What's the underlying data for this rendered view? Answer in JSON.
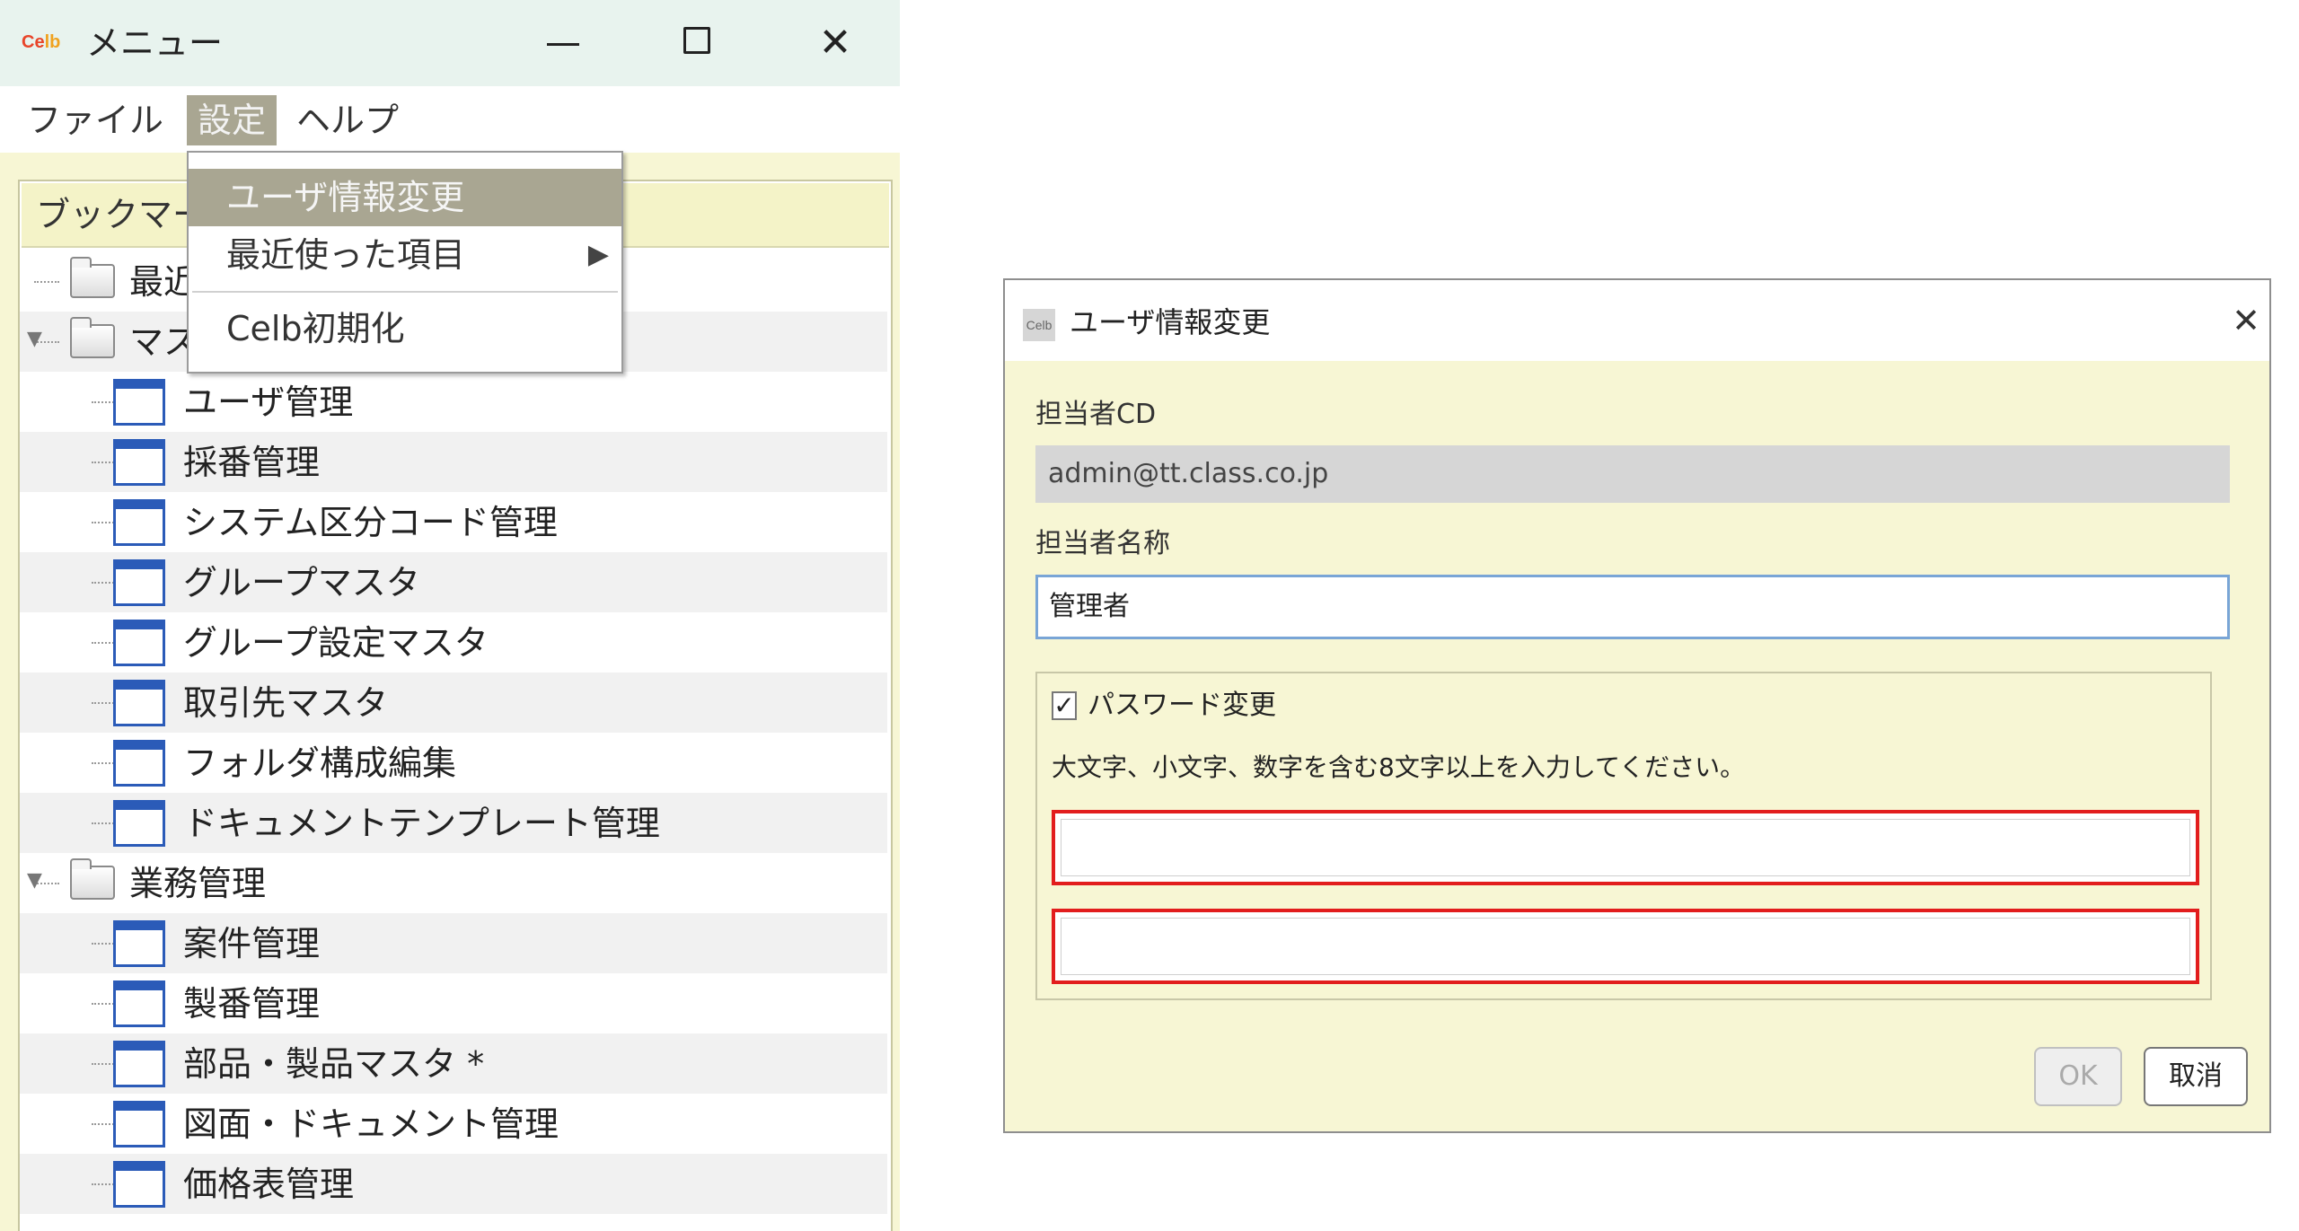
{
  "menu_window": {
    "title": "メニュー",
    "logo": {
      "part1": "Ce",
      "part2": "lb"
    },
    "close_glyph": "✕",
    "menubar": {
      "file": "ファイル",
      "settings": "設定",
      "help": "ヘルプ"
    },
    "bookmark_title": "ブックマーク",
    "tree": [
      {
        "type": "folder",
        "label": "最近",
        "expanded": false
      },
      {
        "type": "folder",
        "label": "マス",
        "expanded": true
      },
      {
        "type": "screen",
        "label": "ユーザ管理"
      },
      {
        "type": "screen",
        "label": "採番管理"
      },
      {
        "type": "screen",
        "label": "システム区分コード管理"
      },
      {
        "type": "screen",
        "label": "グループマスタ"
      },
      {
        "type": "screen",
        "label": "グループ設定マスタ"
      },
      {
        "type": "screen",
        "label": "取引先マスタ"
      },
      {
        "type": "screen",
        "label": "フォルダ構成編集"
      },
      {
        "type": "screen",
        "label": "ドキュメントテンプレート管理"
      },
      {
        "type": "folder",
        "label": "業務管理",
        "expanded": true
      },
      {
        "type": "screen",
        "label": "案件管理"
      },
      {
        "type": "screen",
        "label": "製番管理"
      },
      {
        "type": "screen",
        "label": "部品・製品マスタ *"
      },
      {
        "type": "screen",
        "label": "図面・ドキュメント管理"
      },
      {
        "type": "screen",
        "label": "価格表管理"
      }
    ],
    "settings_dropdown": {
      "user_info_change": "ユーザ情報変更",
      "recent_items": "最近使った項目",
      "recent_arrow": "▶",
      "celb_init": "Celb初期化"
    }
  },
  "dialog": {
    "title": "ユーザ情報変更",
    "logo": "Celb",
    "close_glyph": "✕",
    "staff_cd_label": "担当者CD",
    "staff_cd_value": "admin@tt.class.co.jp",
    "staff_name_label": "担当者名称",
    "staff_name_value": "管理者",
    "password_change_label": "パスワード変更",
    "password_change_checked": true,
    "check_glyph": "✓",
    "password_hint": "大文字、小文字、数字を含む8文字以上を入力してください。",
    "password_new_value": "",
    "password_confirm_value": "",
    "ok_label": "OK",
    "cancel_label": "取消"
  },
  "colors": {
    "panel_bg": "#f7f6d4",
    "menu_highlight": "#a9a692",
    "error_border": "#e21d1d",
    "focus_border": "#79a5d6",
    "tree_icon_blue": "#2b5bb8"
  }
}
